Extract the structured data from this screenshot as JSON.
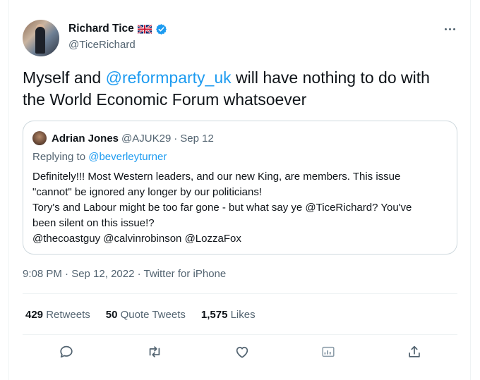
{
  "author": {
    "name": "Richard Tice",
    "handle": "@TiceRichard",
    "flag": "uk-flag",
    "verified": true
  },
  "tweet": {
    "text_before": "Myself and ",
    "mention": "@reformparty_uk",
    "text_after": " will have nothing to do with the World Economic Forum whatsoever"
  },
  "quoted": {
    "name": "Adrian Jones",
    "handle": "@AJUK29",
    "sep": "·",
    "date": "Sep 12",
    "replying_prefix": "Replying to ",
    "replying_to": "@beverleyturner",
    "lines": [
      "Definitely!!! Most Western leaders, and our new King, are members. This issue",
      "\"cannot\" be ignored any longer by our politicians!",
      "Tory's and Labour might be too far gone - but what say ye @TiceRichard? You've",
      "been silent on this issue!?",
      "@thecoastguy @calvinrobinson @LozzaFox"
    ]
  },
  "timestamp": "9:08 PM · Sep 12, 2022 · Twitter for iPhone",
  "stats": [
    {
      "count": "429",
      "label": "Retweets"
    },
    {
      "count": "50",
      "label": "Quote Tweets"
    },
    {
      "count": "1,575",
      "label": "Likes"
    }
  ],
  "actions": [
    "reply-icon",
    "retweet-icon",
    "like-icon",
    "analytics-icon",
    "share-icon"
  ],
  "colors": {
    "accent": "#1d9bf0",
    "text": "#0f1419",
    "muted": "#536471",
    "border": "#cfd9de"
  }
}
